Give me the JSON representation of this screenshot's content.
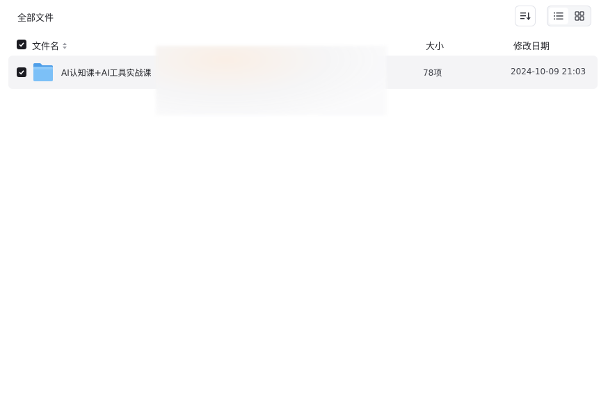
{
  "breadcrumb": {
    "title": "全部文件"
  },
  "toolbar": {
    "sort_icon": "sort-icon",
    "list_view_icon": "list-view-icon",
    "grid_view_icon": "grid-view-icon",
    "active_view": "list"
  },
  "table": {
    "headers": {
      "name": "文件名",
      "size": "大小",
      "date": "修改日期"
    },
    "rows": [
      {
        "name": "AI认知课+AI工具实战课",
        "size": "78项",
        "date": "2024-10-09 21:03",
        "type_icon": "folder-icon",
        "checked": true
      }
    ]
  },
  "colors": {
    "row_background": "#f4f4f6",
    "checkbox": "#1c1c22",
    "folder": "#6ab4f5"
  }
}
